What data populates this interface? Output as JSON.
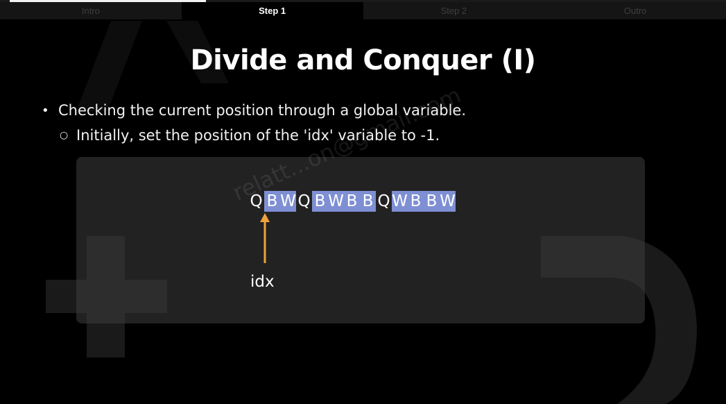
{
  "progress": {
    "fraction": 0.27
  },
  "tabs": [
    {
      "label": "Intro",
      "active": false
    },
    {
      "label": "Step 1",
      "active": true
    },
    {
      "label": "Step 2",
      "active": false
    },
    {
      "label": "Outro",
      "active": false
    }
  ],
  "slide": {
    "title": "Divide and Conquer (I)",
    "bullets": [
      {
        "text": "Checking the current position through a global variable."
      },
      {
        "text": "Initially, set the position of the 'idx' variable to -1."
      }
    ],
    "diagram": {
      "sequence": [
        {
          "char": "Q",
          "highlight": false
        },
        {
          "char": "B",
          "highlight": true
        },
        {
          "char": "W",
          "highlight": true
        },
        {
          "char": "Q",
          "highlight": false
        },
        {
          "char": "B",
          "highlight": true
        },
        {
          "char": "W",
          "highlight": true
        },
        {
          "char": "B",
          "highlight": true
        },
        {
          "char": "B",
          "highlight": true
        },
        {
          "char": "Q",
          "highlight": false
        },
        {
          "char": "W",
          "highlight": true
        },
        {
          "char": "B",
          "highlight": true
        },
        {
          "char": "B",
          "highlight": true
        },
        {
          "char": "W",
          "highlight": true
        }
      ],
      "pointer_label": "idx",
      "highlight_color": "#7e8fd3",
      "arrow_color": "#f0a23a"
    },
    "watermark": "relatt...on@gmail.com"
  }
}
